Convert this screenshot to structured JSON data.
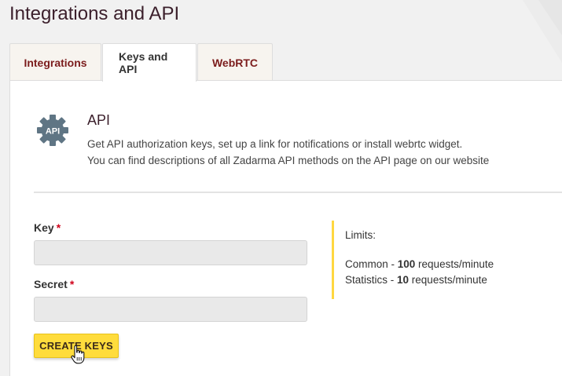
{
  "page": {
    "title": "Integrations and API"
  },
  "tabs": [
    {
      "label": "Integrations",
      "active": false
    },
    {
      "label": "Keys and API",
      "active": true
    },
    {
      "label": "WebRTC",
      "active": false
    }
  ],
  "api": {
    "icon_label": "API",
    "title": "API",
    "description_line1": "Get API authorization keys, set up a link for notifications or install webrtc widget.",
    "description_line2": "You can find descriptions of all Zadarma API methods on the API page on our website"
  },
  "form": {
    "key_label": "Key",
    "key_value": "",
    "secret_label": "Secret",
    "secret_value": "",
    "required_mark": "*",
    "create_button": "CREATE KEYS"
  },
  "limits": {
    "title": "Limits:",
    "common_prefix": "Common - ",
    "common_value": "100",
    "common_suffix": " requests/minute",
    "stats_prefix": "Statistics - ",
    "stats_value": "10",
    "stats_suffix": " requests/minute"
  },
  "colors": {
    "accent_yellow": "#ffdc3c",
    "tab_text": "#7b1c1c",
    "title_text": "#3b1f2b",
    "required": "#d0021b",
    "icon_gear": "#5f7584"
  },
  "icons": {
    "api": "gear-icon",
    "cursor": "hand-pointer-icon"
  }
}
